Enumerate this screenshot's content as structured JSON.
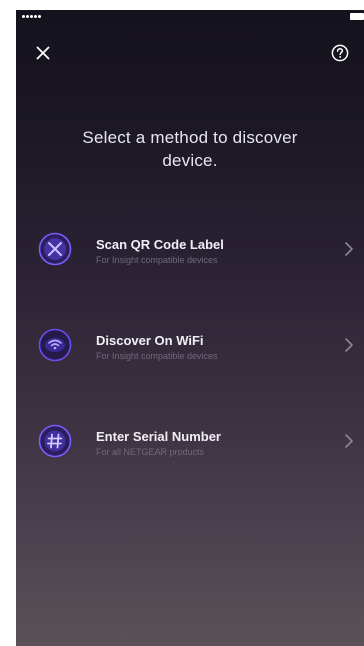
{
  "header": {
    "close_icon": "close-icon",
    "help_icon": "question-circle-icon"
  },
  "title": "Select a method to discover device.",
  "methods": [
    {
      "label": "Scan QR Code Label",
      "sublabel": "For Insight compatible devices",
      "icon": "qr-scan-icon"
    },
    {
      "label": "Discover On WiFi",
      "sublabel": "For Insight compatible devices",
      "icon": "wifi-icon"
    },
    {
      "label": "Enter Serial Number",
      "sublabel": "For all NETGEAR products",
      "icon": "hash-icon"
    }
  ],
  "colors": {
    "accent": "#6a4cf0",
    "accent_ring": "#7c5cff",
    "text": "#f1eff4",
    "subtext": "#6e6a7a"
  }
}
